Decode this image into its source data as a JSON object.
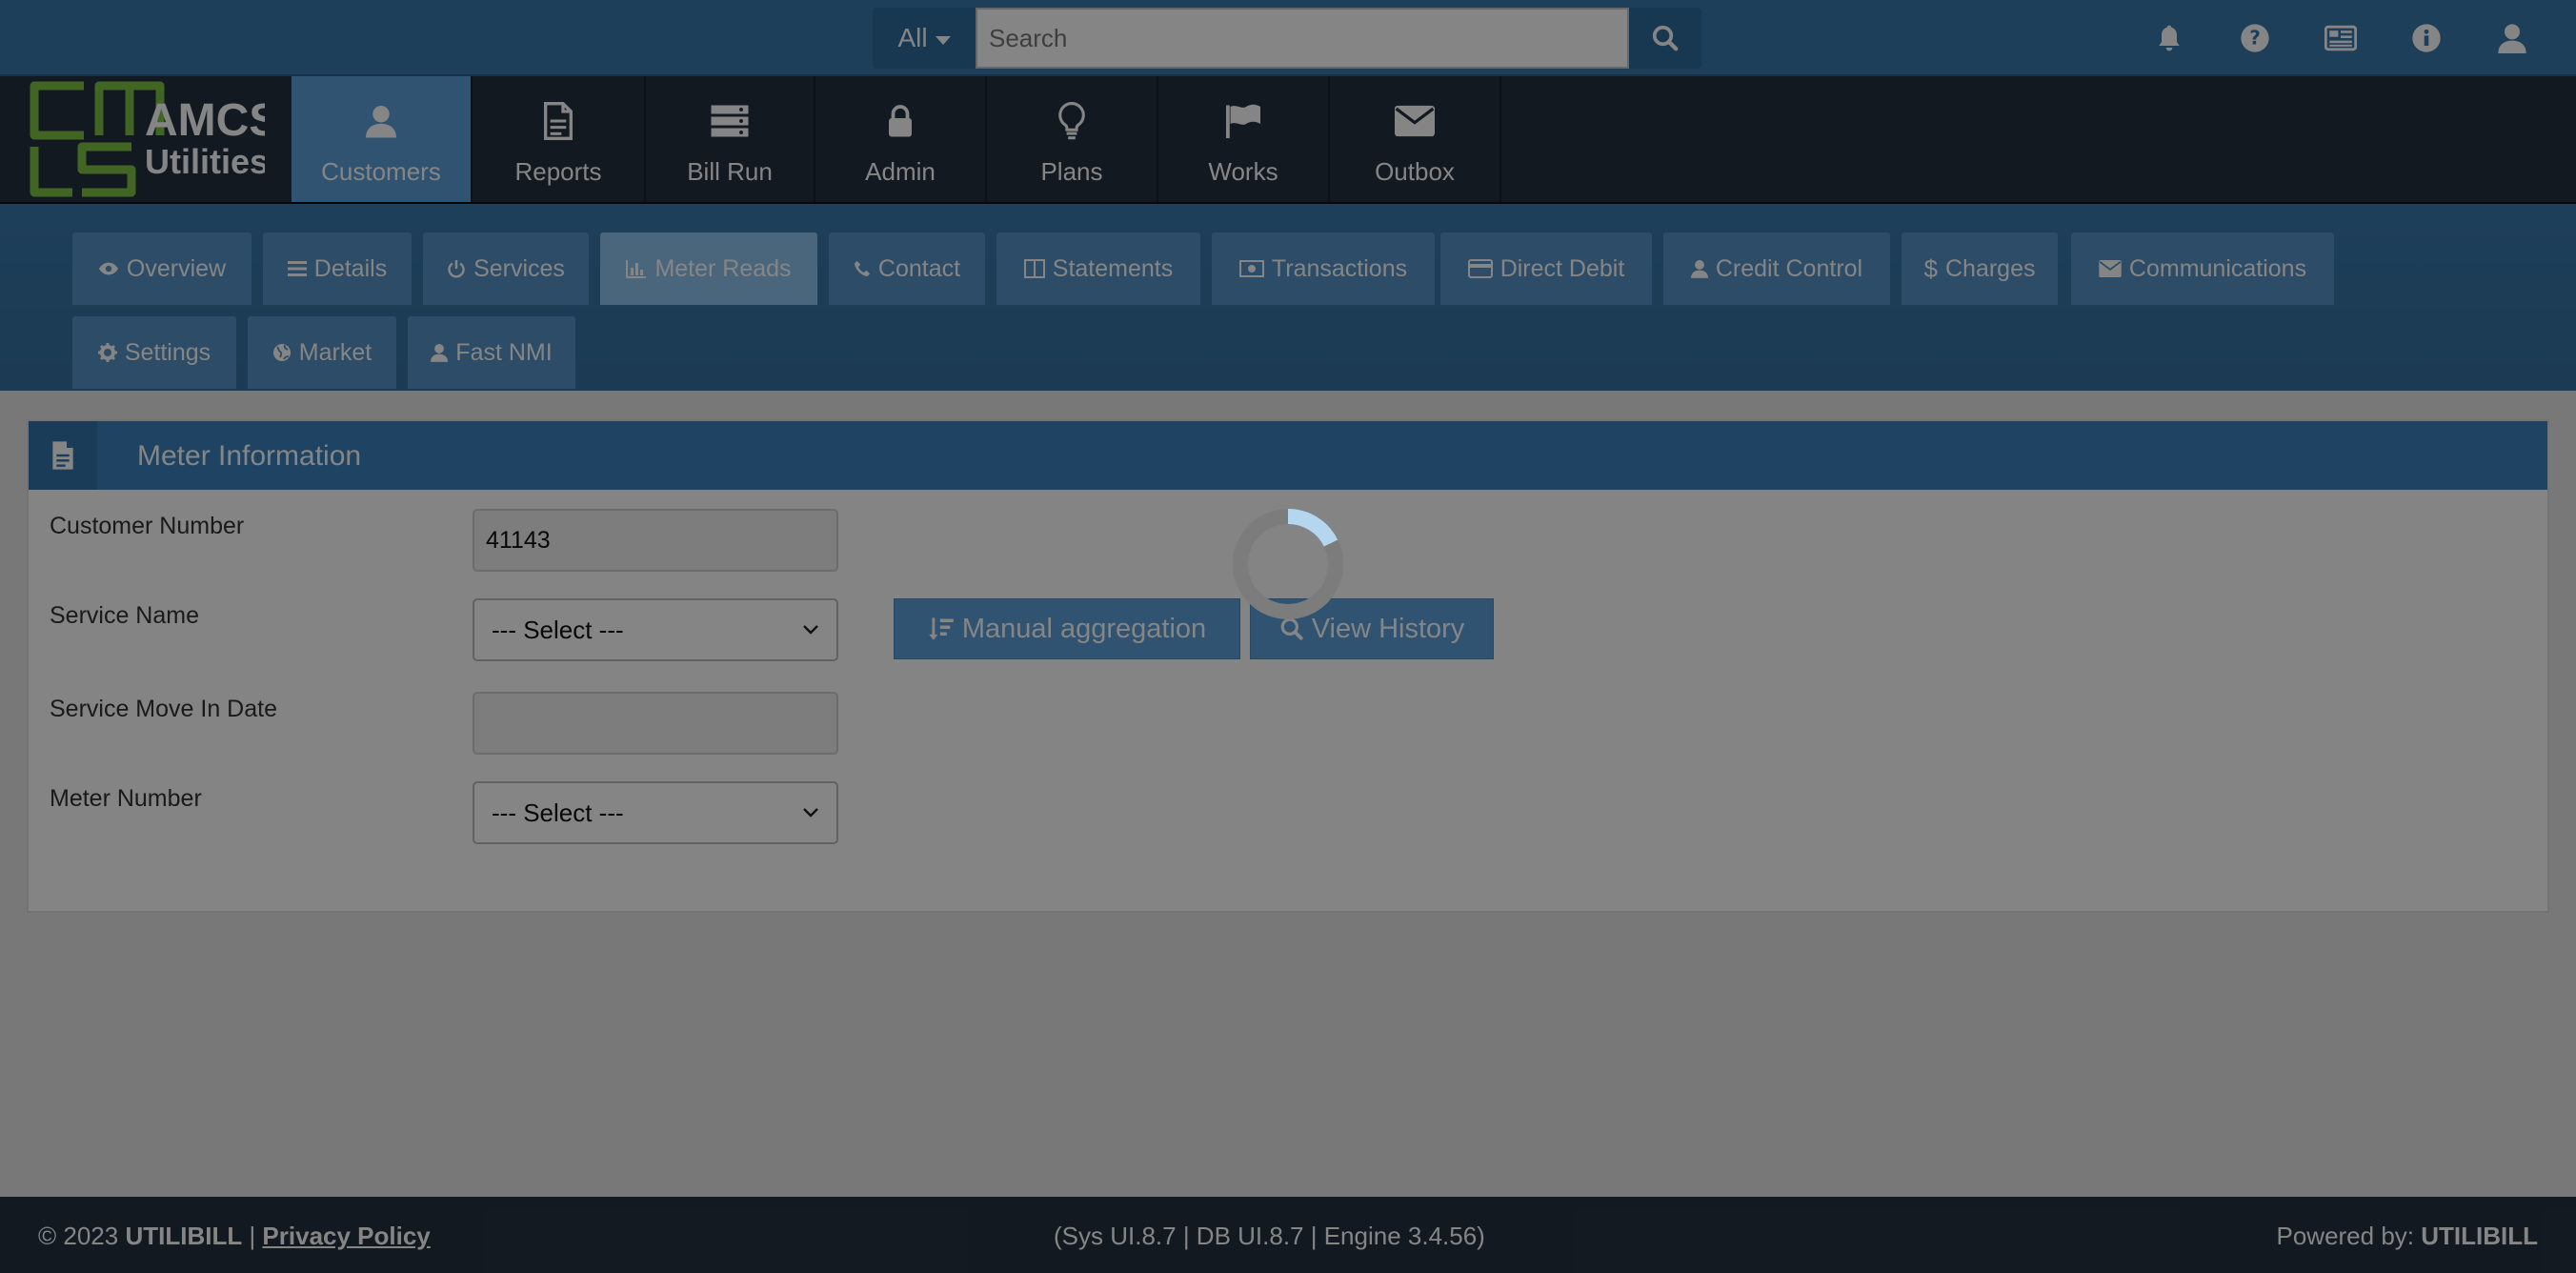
{
  "topbar": {
    "search_scope": "All",
    "search_placeholder": "Search",
    "icons": [
      "bell-icon",
      "question-circle-icon",
      "newspaper-icon",
      "info-circle-icon",
      "user-icon"
    ]
  },
  "logo": {
    "line1": "AMCS",
    "line2": "Utilities"
  },
  "mainnav": {
    "items": [
      {
        "label": "Customers",
        "icon": "user-icon",
        "active": true
      },
      {
        "label": "Reports",
        "icon": "file-icon",
        "active": false
      },
      {
        "label": "Bill Run",
        "icon": "server-icon",
        "active": false
      },
      {
        "label": "Admin",
        "icon": "lock-icon",
        "active": false
      },
      {
        "label": "Plans",
        "icon": "lightbulb-icon",
        "active": false
      },
      {
        "label": "Works",
        "icon": "flag-icon",
        "active": false
      },
      {
        "label": "Outbox",
        "icon": "envelope-icon",
        "active": false
      }
    ]
  },
  "subnav": {
    "tabs": [
      {
        "label": "Overview",
        "icon": "eye-icon"
      },
      {
        "label": "Details",
        "icon": "bars-icon"
      },
      {
        "label": "Services",
        "icon": "power-icon"
      },
      {
        "label": "Meter Reads",
        "icon": "bar-chart-icon",
        "active": true
      },
      {
        "label": "Contact",
        "icon": "phone-icon"
      },
      {
        "label": "Statements",
        "icon": "columns-icon"
      },
      {
        "label": "Transactions",
        "icon": "money-icon"
      },
      {
        "label": "Direct Debit",
        "icon": "credit-card-icon"
      },
      {
        "label": "Credit Control",
        "icon": "user-icon"
      },
      {
        "label": "Charges",
        "icon": "dollar-icon"
      },
      {
        "label": "Communications",
        "icon": "envelope-icon"
      },
      {
        "label": "Settings",
        "icon": "gear-icon"
      },
      {
        "label": "Market",
        "icon": "globe-icon"
      },
      {
        "label": "Fast NMI",
        "icon": "user-icon"
      }
    ]
  },
  "panel": {
    "title": "Meter Information",
    "fields": {
      "customer_number_label": "Customer Number",
      "customer_number_value": "41143",
      "service_name_label": "Service Name",
      "service_name_value": "--- Select ---",
      "move_in_label": "Service Move In Date",
      "move_in_value": "",
      "meter_number_label": "Meter Number",
      "meter_number_value": "--- Select ---"
    },
    "buttons": {
      "manual_aggregation": "Manual aggregation",
      "view_history": "View History"
    }
  },
  "footer": {
    "copyright": "© 2023 ",
    "brand": "UTILIBILL",
    "separator": " | ",
    "privacy": "Privacy Policy",
    "version": "(Sys UI.8.7 | DB UI.8.7 | Engine 3.4.56)",
    "powered_by": "Powered by: ",
    "powered_brand": "UTILIBILL"
  },
  "colors": {
    "topbar": "#3b7aad",
    "nav_dark": "#263140",
    "nav_active": "#5a9fd6",
    "tab": "#5593c6",
    "tab_active": "#8cc4ee",
    "panel_header": "#3d82be",
    "logo_green": "#7dc242"
  },
  "overlay": {
    "loading": true
  }
}
